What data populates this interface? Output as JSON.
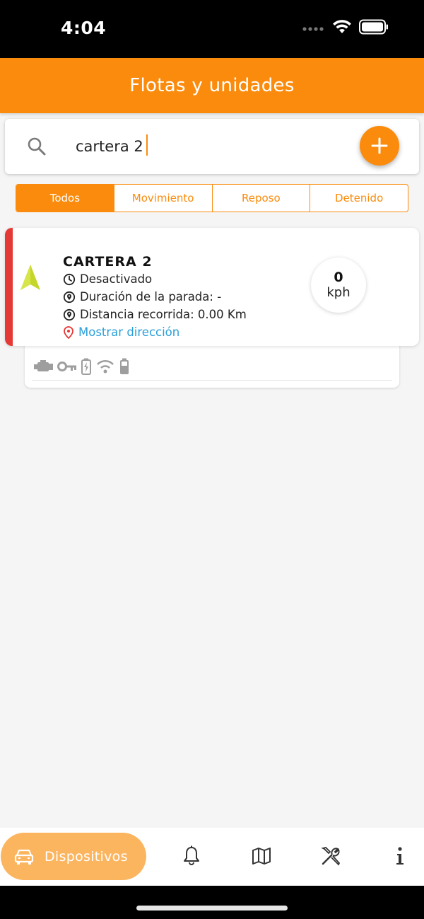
{
  "status_bar": {
    "time": "4:04"
  },
  "header": {
    "title": "Flotas y unidades"
  },
  "search": {
    "value": "cartera 2",
    "add_label": "+"
  },
  "filters": {
    "tabs": [
      {
        "label": "Todos"
      },
      {
        "label": "Movimiento"
      },
      {
        "label": "Reposo"
      },
      {
        "label": "Detenido"
      }
    ]
  },
  "device": {
    "name": "CARTERA 2",
    "status": "Desactivado",
    "stop_duration": "Duración de la parada: -",
    "distance": "Distancia recorrida: 0.00 Km",
    "address_link": "Mostrar dirección",
    "speed_value": "0",
    "speed_unit": "kph",
    "status_color": "#e53935",
    "arrow_color": "#c4d62a"
  },
  "bottom_nav": {
    "active_label": "Dispositivos",
    "items": [
      "car-icon",
      "bell-icon",
      "map-icon",
      "tools-icon",
      "info-icon"
    ]
  },
  "colors": {
    "accent": "#fb8b0c",
    "accent_light": "#fcb55f",
    "link": "#2a9fd8"
  }
}
